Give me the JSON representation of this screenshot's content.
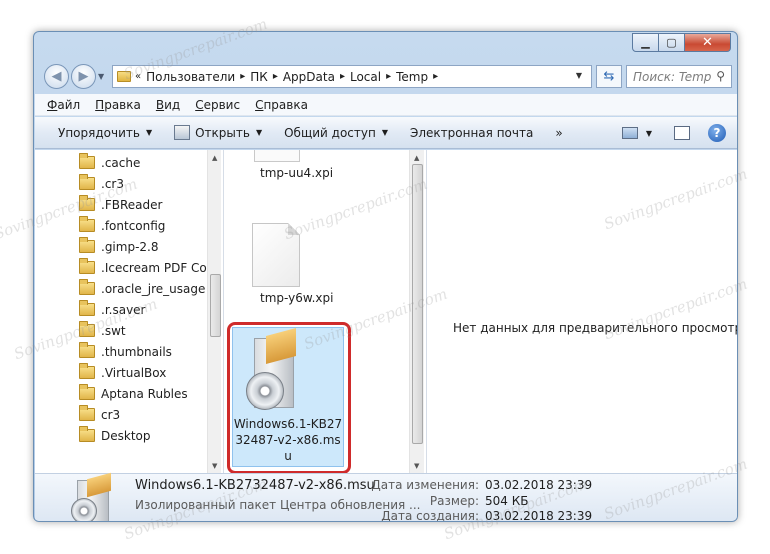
{
  "titlebar": {
    "min": "▁",
    "max": "▢",
    "close": "✕"
  },
  "address": {
    "root_glyph": "«",
    "crumbs": [
      "Пользователи",
      "ПК",
      "AppData",
      "Local",
      "Temp"
    ],
    "sep": "▸",
    "search_placeholder": "Поиск: Temp"
  },
  "menu": {
    "file": "Файл",
    "edit": "Правка",
    "view": "Вид",
    "service": "Сервис",
    "help": "Справка"
  },
  "toolbar": {
    "organize": "Упорядочить",
    "open": "Открыть",
    "share": "Общий доступ",
    "email": "Электронная почта",
    "more": "»",
    "help": "?"
  },
  "tree": [
    ".cache",
    ".cr3",
    ".FBReader",
    ".fontconfig",
    ".gimp-2.8",
    ".Icecream PDF Conv",
    ".oracle_jre_usage",
    ".r.saver",
    ".swt",
    ".thumbnails",
    ".VirtualBox",
    "Aptana Rubles",
    "cr3",
    "Desktop"
  ],
  "files": {
    "file1": "tmp-uu4.xpi",
    "file2": "tmp-y6w.xpi",
    "selected": "Windows6.1-KB2732487-v2-x86.msu"
  },
  "preview": {
    "message": "Нет данных для предварительного просмотра."
  },
  "details": {
    "name": "Windows6.1-KB2732487-v2-x86.msu",
    "type": "Изолированный пакет Центра обновления ...",
    "modified_label": "Дата изменения:",
    "modified": "03.02.2018 23:39",
    "size_label": "Размер:",
    "size": "504 КБ",
    "created_label": "Дата создания:",
    "created": "03.02.2018 23:39"
  },
  "watermark": "Sovingpcrepair.com",
  "colors": {
    "accent": "#cf2b2b",
    "selection": "#cde8fb"
  }
}
